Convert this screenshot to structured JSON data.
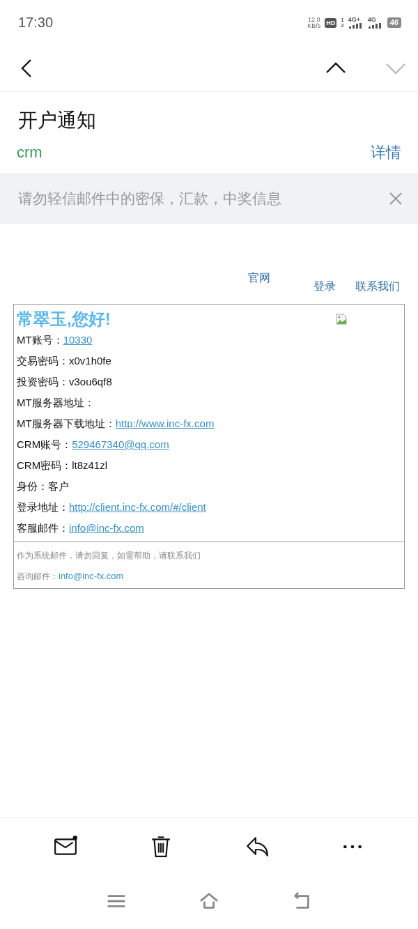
{
  "status_bar": {
    "time": "17:30",
    "speed_value": "12.0",
    "speed_unit": "KB/s",
    "hd": "HD",
    "sim_slots": [
      "1",
      "2"
    ],
    "networks": [
      "4G+",
      "4G"
    ],
    "battery": "46"
  },
  "nav": [
    {
      "kind": "back",
      "disabled": false
    },
    {
      "kind": "up",
      "disabled": false
    },
    {
      "kind": "down",
      "disabled": true
    }
  ],
  "mail": {
    "subject": "开户通知",
    "sender": "crm",
    "details_link": "详情"
  },
  "warning_banner": {
    "text": "请勿轻信邮件中的密保，汇款，中奖信息"
  },
  "email_body": {
    "header_links": [
      {
        "label": "官网"
      },
      {
        "label": "登录"
      },
      {
        "label": "联系我们"
      }
    ],
    "greeting": "常翠玉,您好!",
    "fields": [
      {
        "label": "MT账号：",
        "kind": "link",
        "value": "10330"
      },
      {
        "label": "交易密码：",
        "kind": "text",
        "value": "x0v1h0fe"
      },
      {
        "label": "投资密码：",
        "kind": "text",
        "value": "v3ou6qf8"
      },
      {
        "label": "MT服务器地址：",
        "kind": "empty"
      },
      {
        "label": "MT服务器下载地址：",
        "kind": "link",
        "value": "http://www.inc-fx.com"
      },
      {
        "label": "CRM账号：",
        "kind": "link",
        "value": "529467340@qq.com"
      },
      {
        "label": "CRM密码：",
        "kind": "text",
        "value": "lt8z41zl"
      },
      {
        "label": "身份：",
        "kind": "text",
        "value": "客户"
      },
      {
        "label": "登录地址：",
        "kind": "link",
        "value": "http://client.inc-fx.com/#/client"
      },
      {
        "label": "客服邮件：",
        "kind": "link",
        "value": "info@inc-fx.com"
      }
    ],
    "footer_note": "作为系统邮件，请勿回复，如需帮助，请联系我们",
    "footer_contact": {
      "label": "咨询邮件：",
      "link": "info@inc-fx.com"
    }
  },
  "toolbar": [
    {
      "kind": "mark_unread"
    },
    {
      "kind": "delete"
    },
    {
      "kind": "reply"
    },
    {
      "kind": "more"
    }
  ],
  "system_nav": [
    {
      "kind": "menu"
    },
    {
      "kind": "home"
    },
    {
      "kind": "back"
    }
  ]
}
